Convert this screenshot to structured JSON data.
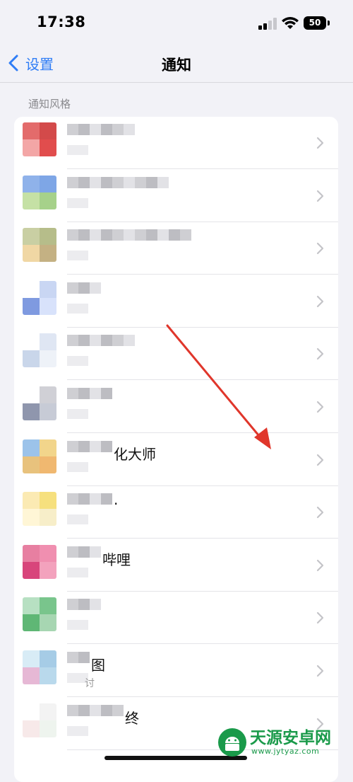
{
  "status_bar": {
    "time": "17:38",
    "battery": "50"
  },
  "nav": {
    "back_label": "设置",
    "title": "通知"
  },
  "section": {
    "header": "通知风格"
  },
  "rows": [
    {
      "icon": [
        "#e36b6b",
        "#d34a4a",
        "#f3a6a6",
        "#e14d4d"
      ],
      "name": "",
      "sub": ""
    },
    {
      "icon": [
        "#8fb2ea",
        "#7ea6e6",
        "#c5e1a5",
        "#a6d18a"
      ],
      "name": "",
      "sub": ""
    },
    {
      "icon": [
        "#c9cfa3",
        "#b6bd8a",
        "#f0d7a4",
        "#c4b183"
      ],
      "name": "",
      "sub": ""
    },
    {
      "icon": [
        "#ffffff",
        "#c9d6f3",
        "#7f9ae0",
        "#d8e2fb"
      ],
      "name": "",
      "sub": ""
    },
    {
      "icon": [
        "#ffffff",
        "#dfe6f3",
        "#c9d6ea",
        "#eef2f8"
      ],
      "name": "",
      "sub": ""
    },
    {
      "icon": [
        "#ffffff",
        "#d0d0d6",
        "#8f96ad",
        "#c7cbd6"
      ],
      "name": "",
      "sub": ""
    },
    {
      "icon": [
        "#9cc3ea",
        "#f2d58b",
        "#e8c27d",
        "#f0b870"
      ],
      "name": "化大师",
      "sub": ""
    },
    {
      "icon": [
        "#fbeab3",
        "#f6e07e",
        "#fff6d6",
        "#f7eec9"
      ],
      "name": "·",
      "sub": ""
    },
    {
      "icon": [
        "#e77fa1",
        "#f08fb0",
        "#d8457b",
        "#f3a2bd"
      ],
      "name": "哔哩",
      "sub": ""
    },
    {
      "icon": [
        "#b7e0c2",
        "#79c58c",
        "#5fb775",
        "#a7d6b2"
      ],
      "name": "",
      "sub": ""
    },
    {
      "icon": [
        "#d8ecf6",
        "#a6cce6",
        "#e6b8d5",
        "#b9d9ec"
      ],
      "name": "图",
      "sub": "讨"
    },
    {
      "icon": [
        "#ffffff",
        "#f3f3f3",
        "#f7e9e9",
        "#eef4ee"
      ],
      "name": "终",
      "sub": ""
    }
  ],
  "watermark": {
    "main": "天源安卓网",
    "sub": "www.jytyaz.com"
  },
  "colors": {
    "accent": "#2f7df6",
    "arrow": "#e0362b"
  }
}
